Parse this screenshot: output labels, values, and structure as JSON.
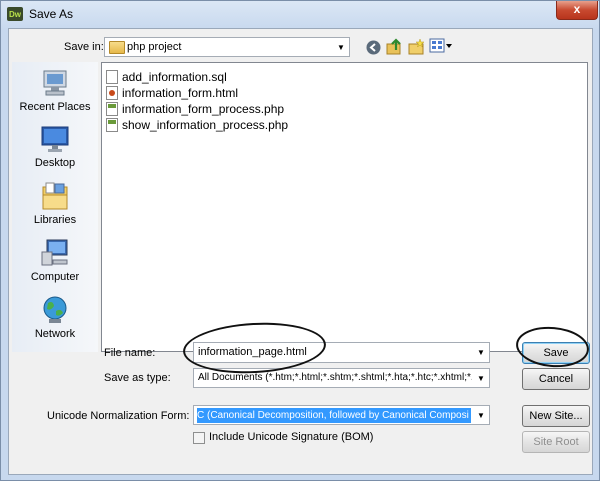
{
  "window": {
    "title": "Save As",
    "app_logo": "Dw",
    "close_label": "x"
  },
  "toolbar": {
    "save_in_label": "Save in:",
    "current_folder": "php project",
    "icons": [
      "back-icon",
      "up-folder-icon",
      "new-folder-icon",
      "view-menu-icon"
    ]
  },
  "places": [
    {
      "label": "Recent Places",
      "icon": "recent-places-icon"
    },
    {
      "label": "Desktop",
      "icon": "desktop-icon"
    },
    {
      "label": "Libraries",
      "icon": "libraries-icon"
    },
    {
      "label": "Computer",
      "icon": "computer-icon"
    },
    {
      "label": "Network",
      "icon": "network-icon"
    }
  ],
  "files": [
    {
      "name": "add_information.sql",
      "icon": "sql-file-icon"
    },
    {
      "name": "information_form.html",
      "icon": "html-file-icon"
    },
    {
      "name": "information_form_process.php",
      "icon": "php-file-icon"
    },
    {
      "name": "show_information_process.php",
      "icon": "php-file-icon"
    }
  ],
  "form": {
    "file_name_label": "File name:",
    "file_name_value": "information_page.html",
    "save_as_type_label": "Save as type:",
    "save_as_type_value": "All Documents (*.htm;*.html;*.shtm;*.shtml;*.hta;*.htc;*.xhtml;*.s",
    "unicode_label": "Unicode Normalization Form:",
    "unicode_value": "C (Canonical Decomposition, followed by Canonical Composi",
    "bom_label": "Include Unicode Signature (BOM)",
    "bom_checked": false
  },
  "buttons": {
    "save": "Save",
    "cancel": "Cancel",
    "new_site": "New Site...",
    "site_root": "Site Root"
  },
  "colors": {
    "highlight": "#3399ff",
    "title_bg": "#c7d8ee",
    "close_red": "#c84a30"
  }
}
